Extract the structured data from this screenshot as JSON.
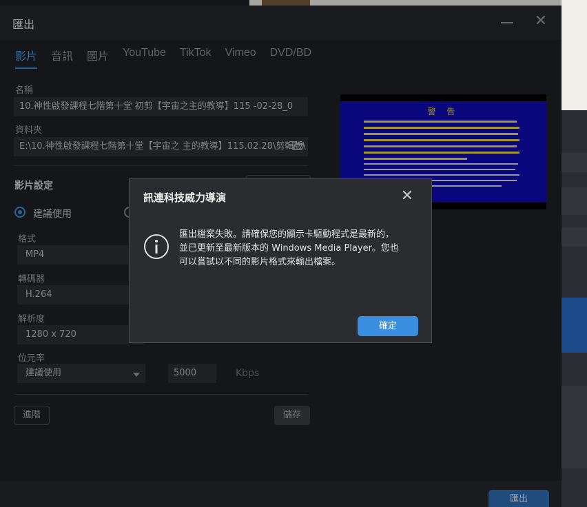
{
  "window": {
    "title": "匯出",
    "close_glyph": "✕"
  },
  "tabs": [
    "影片",
    "音訊",
    "圖片",
    "YouTube",
    "TikTok",
    "Vimeo",
    "DVD/BD"
  ],
  "name": {
    "label": "名稱",
    "value": "10.神性啟發課程七階第十堂 初剪【宇宙之主的教導】115 -02-28_0"
  },
  "folder": {
    "label": "資料夾",
    "value": "E:\\10.神性啟發課程七階第十堂【宇宙之 主的教導】115.02.28\\剪輯版\\",
    "icon": "folder-open-icon"
  },
  "video_settings": {
    "title": "影片設定",
    "recommended_label": "建議使用",
    "format_label": "格式",
    "format_value": "MP4",
    "codec_label": "轉碼器",
    "codec_value": "H.264",
    "resolution_label": "解析度",
    "resolution_value": "1280 x 720",
    "bitrate_label": "位元率",
    "bitrate_mode": "建議使用",
    "bitrate_value": "5000",
    "bitrate_unit": "Kbps",
    "advanced_button": "進階",
    "save_button": "儲存"
  },
  "preview": {
    "title": "警 告"
  },
  "export_button": "匯出",
  "dialog": {
    "title": "訊連科技威力導演",
    "close_glyph": "✕",
    "icon": "info-icon",
    "message_lines": [
      "匯出檔案失敗。請確保您的顯示卡驅動程式是最新的，",
      "並已更新至最新版本的 Windows Media Player。您也",
      "可以嘗試以不同的影片格式來輸出檔案。"
    ],
    "ok_button": "確定"
  },
  "colors": {
    "accent": "#3a8ee0",
    "tab_active": "#4a9fe8",
    "preview_bg": "#0d0bb0",
    "preview_text": "#e8d84a"
  }
}
